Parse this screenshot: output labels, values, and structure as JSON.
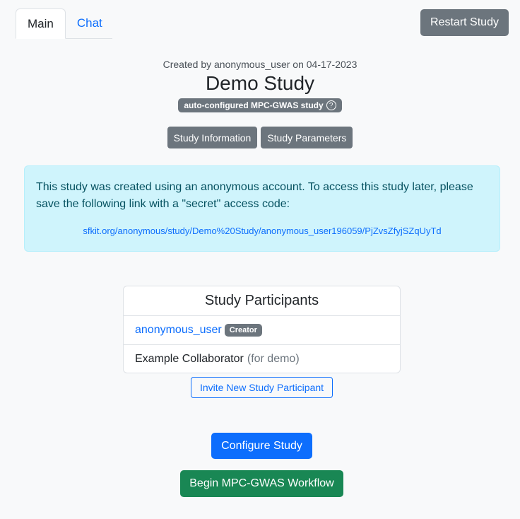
{
  "tabs": [
    {
      "label": "Main",
      "active": true
    },
    {
      "label": "Chat",
      "active": false
    }
  ],
  "header": {
    "restart_label": "Restart Study"
  },
  "study": {
    "created_by_text": "Created by anonymous_user on 04-17-2023",
    "title": "Demo Study",
    "type_badge": "auto-configured MPC-GWAS study",
    "help_icon": "?",
    "info_button": "Study Information",
    "params_button": "Study Parameters"
  },
  "alert": {
    "message": "This study was created using an anonymous account. To access this study later, please save the following link with a \"secret\" access code:",
    "link": "sfkit.org/anonymous/study/Demo%20Study/anonymous_user196059/PjZvsZfyjSZqUyTd"
  },
  "participants": {
    "title": "Study Participants",
    "rows": [
      {
        "name": "anonymous_user",
        "badge": "Creator"
      },
      {
        "name": "Example Collaborator",
        "note": "(for demo)"
      }
    ],
    "invite_label": "Invite New Study Participant"
  },
  "actions": {
    "configure_label": "Configure Study",
    "begin_label": "Begin MPC-GWAS Workflow"
  },
  "colors": {
    "primary": "#0d6efd",
    "secondary": "#6c757d",
    "success": "#198754",
    "info_bg": "#cff4fc"
  }
}
